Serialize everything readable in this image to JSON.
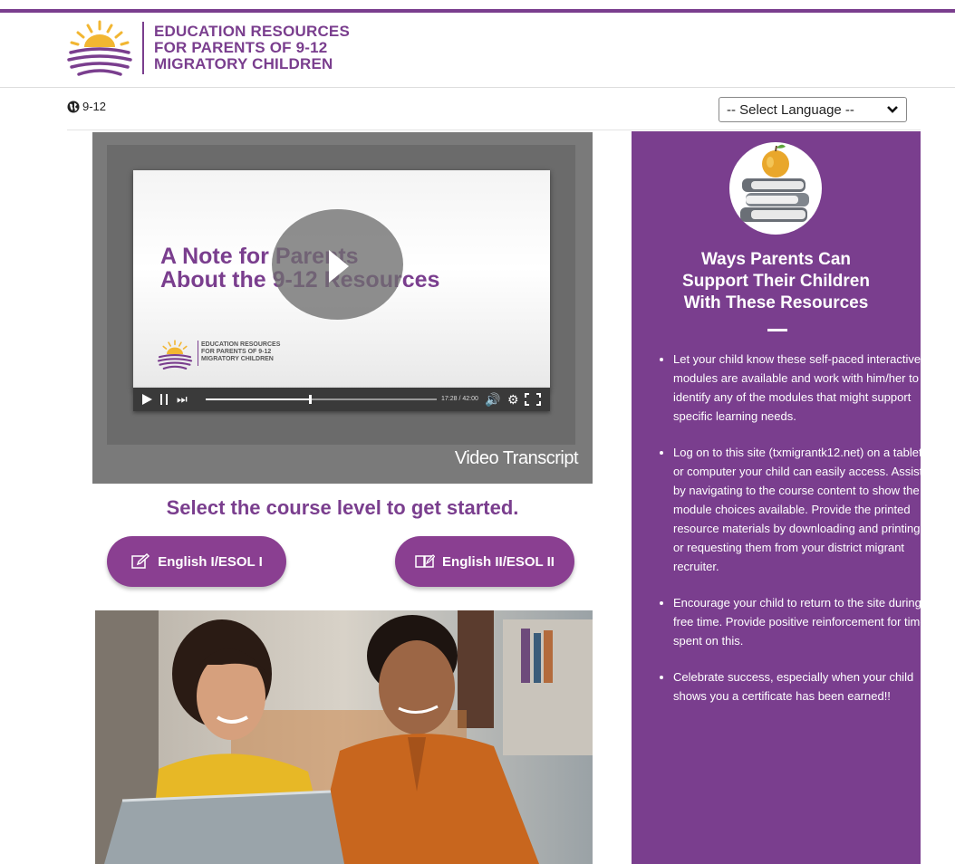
{
  "header": {
    "logo_lines": [
      "EDUCATION RESOURCES",
      "FOR PARENTS OF 9-12",
      "MIGRATORY CHILDREN"
    ],
    "colors": {
      "brand": "#7a3e8e",
      "sun": "#f2b632"
    }
  },
  "nav": {
    "crumb_icon": "globe-icon",
    "crumb_label": "9-12",
    "language_select": {
      "selected": "-- Select Language --"
    }
  },
  "video": {
    "slide_title_line1": "A Note for Parents",
    "slide_title_line2": "About the 9-12 Resources",
    "mini_logo_lines": [
      "EDUCATION RESOURCES",
      "FOR PARENTS OF 9-12",
      "MIGRATORY CHILDREN"
    ],
    "time": "17:28 / 42:00",
    "progress": 0.45,
    "transcript_label": "Video Transcript"
  },
  "main": {
    "cta_heading": "Select the course level to get started.",
    "buttons": [
      {
        "label": "English I/ESOL I",
        "icon": "edit-icon"
      },
      {
        "label": "English II/ESOL II",
        "icon": "book-icon"
      }
    ]
  },
  "sidebar": {
    "icon": "books-apple-icon",
    "title": "Ways Parents Can Support Their Children With These Resources",
    "items": [
      "Let your child know these self-paced interactive modules are available and work with him/her to identify any of the modules that might support specific learning needs.",
      "Log on to this site (txmigrantk12.net) on a tablet or computer your child can easily access. Assist by navigating to the course content to show the module choices available. Provide the printed resource materials by downloading and printing or requesting them from your district migrant recruiter.",
      "Encourage your child to return to the site during free time. Provide positive reinforcement for time spent on this.",
      "Celebrate success, especially when your child shows you a certificate has been earned!!"
    ]
  }
}
